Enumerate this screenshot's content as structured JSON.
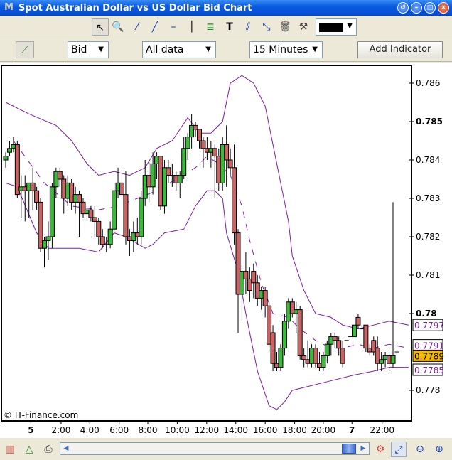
{
  "window": {
    "title": "Spot Australian Dollar vs US Dollar Bid Chart",
    "buttons": [
      "help",
      "minimize",
      "maximize",
      "close"
    ]
  },
  "toolbar": {
    "tools": [
      "pointer-icon",
      "zoom-in-icon",
      "line-icon",
      "trend-line-icon",
      "horizontal-line-icon",
      "vertical-line-icon",
      "fibonacci-icon",
      "text-icon",
      "parallel-lines-icon",
      "channel-icon",
      "trash-icon",
      "tools-icon"
    ],
    "color": "#000000"
  },
  "controls": {
    "price_type": "Bid",
    "range": "All data",
    "interval": "15 Minutes",
    "add_indicator": "Add Indicator"
  },
  "footer": {
    "copyright": "© IT-Finance.com"
  },
  "chart_data": {
    "type": "candlestick",
    "title": "Spot Australian Dollar vs US Dollar Bid Chart",
    "ylim": [
      0.7772,
      0.7867
    ],
    "yticks": [
      {
        "v": 0.786,
        "label": "0.786",
        "bold": false
      },
      {
        "v": 0.785,
        "label": "0.785",
        "bold": true
      },
      {
        "v": 0.784,
        "label": "0.784",
        "bold": false
      },
      {
        "v": 0.783,
        "label": "0.783",
        "bold": false
      },
      {
        "v": 0.782,
        "label": "0.782",
        "bold": false
      },
      {
        "v": 0.781,
        "label": "0.781",
        "bold": false
      },
      {
        "v": 0.78,
        "label": "0.78",
        "bold": true
      },
      {
        "v": 0.778,
        "label": "0.778",
        "bold": false
      }
    ],
    "xticks": [
      {
        "slot": 6.5,
        "label": "5",
        "bold": true
      },
      {
        "slot": 14.3,
        "label": "2:00"
      },
      {
        "slot": 21.7,
        "label": "4:00"
      },
      {
        "slot": 29.3,
        "label": "6:00"
      },
      {
        "slot": 36.7,
        "label": "8:00"
      },
      {
        "slot": 44.3,
        "label": "10:00"
      },
      {
        "slot": 51.9,
        "label": "12:00"
      },
      {
        "slot": 59.4,
        "label": "14:00"
      },
      {
        "slot": 67,
        "label": "16:00"
      },
      {
        "slot": 74.6,
        "label": "18:00"
      },
      {
        "slot": 82,
        "label": "20:00"
      },
      {
        "slot": 89.4,
        "label": "7",
        "bold": true
      },
      {
        "slot": 97.2,
        "label": "22:00"
      }
    ],
    "price_labels": [
      {
        "v": 0.7797,
        "label": "0.7797",
        "kind": "upper"
      },
      {
        "v": 0.7791,
        "label": "0.7791",
        "kind": "middle"
      },
      {
        "v": 0.7789,
        "label": "0.7789",
        "kind": "last"
      },
      {
        "v": 0.7785,
        "label": "0.7785",
        "kind": "lower"
      }
    ],
    "colors": {
      "up": "#3cb93c",
      "down": "#c86464",
      "band": "#7a1fa8",
      "last_bg": "#f5b800"
    },
    "candles": [
      [
        0.784,
        0.7842,
        0.7838,
        0.7841
      ],
      [
        0.7842,
        0.7845,
        0.7841,
        0.7843
      ],
      [
        0.7843,
        0.7846,
        0.7842,
        0.7844
      ],
      [
        0.7844,
        0.7845,
        0.783,
        0.7831
      ],
      [
        0.7832,
        0.7836,
        0.7825,
        0.7833
      ],
      [
        0.7833,
        0.7836,
        0.7824,
        0.7832
      ],
      [
        0.7832,
        0.7834,
        0.7825,
        0.7834
      ],
      [
        0.7834,
        0.7838,
        0.7827,
        0.7832
      ],
      [
        0.7832,
        0.7833,
        0.7827,
        0.7829
      ],
      [
        0.7829,
        0.783,
        0.7816,
        0.7817
      ],
      [
        0.7817,
        0.782,
        0.7812,
        0.7819
      ],
      [
        0.7819,
        0.7824,
        0.7814,
        0.782
      ],
      [
        0.782,
        0.7834,
        0.7817,
        0.7833
      ],
      [
        0.7833,
        0.7838,
        0.783,
        0.7837
      ],
      [
        0.7837,
        0.7838,
        0.7833,
        0.7835
      ],
      [
        0.7835,
        0.7836,
        0.7826,
        0.783
      ],
      [
        0.783,
        0.7836,
        0.7828,
        0.7834
      ],
      [
        0.7834,
        0.7835,
        0.7827,
        0.7829
      ],
      [
        0.7829,
        0.7833,
        0.7826,
        0.7831
      ],
      [
        0.7831,
        0.7832,
        0.782,
        0.7829
      ],
      [
        0.7829,
        0.783,
        0.7825,
        0.7826
      ],
      [
        0.7826,
        0.7828,
        0.7824,
        0.7827
      ],
      [
        0.7827,
        0.7828,
        0.7824,
        0.7825
      ],
      [
        0.7825,
        0.7828,
        0.782,
        0.7824
      ],
      [
        0.7824,
        0.7825,
        0.7818,
        0.782
      ],
      [
        0.782,
        0.7822,
        0.7817,
        0.7818
      ],
      [
        0.7818,
        0.782,
        0.7816,
        0.7818
      ],
      [
        0.7818,
        0.7824,
        0.7817,
        0.7822
      ],
      [
        0.7822,
        0.7834,
        0.7821,
        0.7832
      ],
      [
        0.7832,
        0.7838,
        0.783,
        0.7834
      ],
      [
        0.7834,
        0.7838,
        0.783,
        0.7831
      ],
      [
        0.7831,
        0.7837,
        0.7818,
        0.782
      ],
      [
        0.782,
        0.7822,
        0.7815,
        0.7819
      ],
      [
        0.7819,
        0.7824,
        0.7816,
        0.7821
      ],
      [
        0.7821,
        0.7825,
        0.7818,
        0.782
      ],
      [
        0.782,
        0.7832,
        0.7818,
        0.783
      ],
      [
        0.783,
        0.784,
        0.7828,
        0.7836
      ],
      [
        0.7836,
        0.784,
        0.7829,
        0.7833
      ],
      [
        0.7833,
        0.7842,
        0.7831,
        0.7839
      ],
      [
        0.7839,
        0.7842,
        0.7835,
        0.7841
      ],
      [
        0.7841,
        0.7841,
        0.7827,
        0.7828
      ],
      [
        0.7828,
        0.784,
        0.7826,
        0.7838
      ],
      [
        0.7838,
        0.784,
        0.7834,
        0.7836
      ],
      [
        0.7836,
        0.7839,
        0.7833,
        0.7836
      ],
      [
        0.7836,
        0.7837,
        0.7832,
        0.7834
      ],
      [
        0.7834,
        0.7837,
        0.783,
        0.7836
      ],
      [
        0.7836,
        0.7846,
        0.7835,
        0.7843
      ],
      [
        0.7843,
        0.7847,
        0.784,
        0.7846
      ],
      [
        0.7846,
        0.7852,
        0.7843,
        0.7849
      ],
      [
        0.7849,
        0.785,
        0.7846,
        0.7848
      ],
      [
        0.7848,
        0.7848,
        0.7843,
        0.7845
      ],
      [
        0.7845,
        0.7846,
        0.7838,
        0.7843
      ],
      [
        0.7843,
        0.7846,
        0.784,
        0.7842
      ],
      [
        0.7842,
        0.7845,
        0.7838,
        0.7843
      ],
      [
        0.7843,
        0.7844,
        0.783,
        0.7841
      ],
      [
        0.7841,
        0.7843,
        0.7832,
        0.7834
      ],
      [
        0.7834,
        0.7846,
        0.7832,
        0.7844
      ],
      [
        0.7844,
        0.7849,
        0.7833,
        0.784
      ],
      [
        0.784,
        0.7843,
        0.7836,
        0.7838
      ],
      [
        0.7838,
        0.7844,
        0.7818,
        0.7821
      ],
      [
        0.7821,
        0.7822,
        0.7795,
        0.7805
      ],
      [
        0.7805,
        0.7813,
        0.7798,
        0.7811
      ],
      [
        0.7811,
        0.7816,
        0.7805,
        0.7809
      ],
      [
        0.7809,
        0.7812,
        0.7803,
        0.7806
      ],
      [
        0.7811,
        0.7813,
        0.7804,
        0.7808
      ],
      [
        0.7808,
        0.781,
        0.7802,
        0.7804
      ],
      [
        0.7804,
        0.7807,
        0.7801,
        0.7806
      ],
      [
        0.7806,
        0.7807,
        0.7799,
        0.7802
      ],
      [
        0.7802,
        0.7803,
        0.779,
        0.7792
      ],
      [
        0.7795,
        0.7797,
        0.7785,
        0.7787
      ],
      [
        0.7787,
        0.779,
        0.7785,
        0.7786
      ],
      [
        0.7786,
        0.7792,
        0.7785,
        0.7791
      ],
      [
        0.7791,
        0.78,
        0.7789,
        0.7798
      ],
      [
        0.7798,
        0.7804,
        0.7796,
        0.7803
      ],
      [
        0.7803,
        0.7804,
        0.7799,
        0.78
      ],
      [
        0.78,
        0.7803,
        0.7795,
        0.7801
      ],
      [
        0.7801,
        0.7802,
        0.7788,
        0.7789
      ],
      [
        0.7789,
        0.7791,
        0.7786,
        0.7788
      ],
      [
        0.7788,
        0.7793,
        0.7786,
        0.7787
      ],
      [
        0.7787,
        0.7792,
        0.7786,
        0.7791
      ],
      [
        0.7791,
        0.7792,
        0.7786,
        0.7787
      ],
      [
        0.7787,
        0.779,
        0.7785,
        0.7786
      ],
      [
        0.7786,
        0.779,
        0.7785,
        0.7789
      ],
      [
        0.7789,
        0.7793,
        0.7787,
        0.7792
      ],
      [
        0.7792,
        0.7795,
        0.7789,
        0.7794
      ],
      [
        0.7794,
        0.7795,
        0.7791,
        0.7793
      ],
      [
        0.7793,
        0.7794,
        0.7789,
        0.7791
      ],
      [
        0.7791,
        0.7793,
        0.7786,
        0.7787
      ],
      [
        0.7793,
        0.7793,
        0.7793,
        0.7793
      ],
      [
        0.7794,
        0.7794,
        0.7794,
        0.7794
      ],
      [
        0.7794,
        0.7797,
        0.7794,
        0.7797
      ],
      [
        0.7799,
        0.78,
        0.7796,
        0.7797
      ],
      [
        0.7796,
        0.7797,
        0.7796,
        0.7796
      ],
      [
        0.7797,
        0.7797,
        0.779,
        0.7791
      ],
      [
        0.7791,
        0.7792,
        0.7789,
        0.779
      ],
      [
        0.7793,
        0.7794,
        0.7789,
        0.779
      ],
      [
        0.7791,
        0.7794,
        0.7785,
        0.7787
      ],
      [
        0.7787,
        0.779,
        0.7785,
        0.7788
      ],
      [
        0.7788,
        0.779,
        0.7786,
        0.7789
      ],
      [
        0.7789,
        0.779,
        0.7785,
        0.7787
      ],
      [
        0.7787,
        0.7829,
        0.7786,
        0.7789
      ],
      [
        0.779,
        0.779,
        0.7789,
        0.779
      ]
    ],
    "bands": {
      "upper": [
        [
          0,
          0.7855
        ],
        [
          6,
          0.7852
        ],
        [
          13,
          0.7849
        ],
        [
          17,
          0.7845
        ],
        [
          21,
          0.7839
        ],
        [
          24,
          0.7836
        ],
        [
          28,
          0.7837
        ],
        [
          32,
          0.7836
        ],
        [
          36,
          0.7838
        ],
        [
          39,
          0.7843
        ],
        [
          43,
          0.7845
        ],
        [
          47,
          0.7851
        ],
        [
          50,
          0.7847
        ],
        [
          53,
          0.7847
        ],
        [
          56,
          0.785
        ],
        [
          58,
          0.786
        ],
        [
          61,
          0.7862
        ],
        [
          64,
          0.786
        ],
        [
          67,
          0.7854
        ],
        [
          70,
          0.7839
        ],
        [
          73,
          0.7824
        ],
        [
          74,
          0.7815
        ],
        [
          77,
          0.7806
        ],
        [
          80,
          0.78
        ],
        [
          84,
          0.7799
        ],
        [
          87,
          0.7797
        ],
        [
          91,
          0.7796
        ],
        [
          95,
          0.7797
        ],
        [
          99,
          0.7798
        ],
        [
          104,
          0.7797
        ]
      ],
      "middle": [
        [
          2,
          0.7845
        ],
        [
          10,
          0.7834
        ],
        [
          17,
          0.7828
        ],
        [
          24,
          0.7827
        ],
        [
          29,
          0.7828
        ],
        [
          34,
          0.783
        ],
        [
          39,
          0.7832
        ],
        [
          44,
          0.7835
        ],
        [
          49,
          0.7838
        ],
        [
          52,
          0.7841
        ],
        [
          55,
          0.7839
        ],
        [
          58,
          0.7836
        ],
        [
          61,
          0.7828
        ],
        [
          63,
          0.7819
        ],
        [
          66,
          0.7808
        ],
        [
          69,
          0.78
        ],
        [
          73,
          0.7799
        ],
        [
          76,
          0.7796
        ],
        [
          80,
          0.7793
        ],
        [
          84,
          0.7791
        ],
        [
          87,
          0.7791
        ],
        [
          91,
          0.7792
        ],
        [
          95,
          0.7791
        ],
        [
          99,
          0.7792
        ],
        [
          104,
          0.7791
        ]
      ],
      "lower": [
        [
          0,
          0.7834
        ],
        [
          3,
          0.7833
        ],
        [
          8,
          0.7821
        ],
        [
          11,
          0.7817
        ],
        [
          19,
          0.7817
        ],
        [
          24,
          0.7816
        ],
        [
          28,
          0.7821
        ],
        [
          31,
          0.782
        ],
        [
          36,
          0.7817
        ],
        [
          38,
          0.7818
        ],
        [
          41,
          0.7821
        ],
        [
          46,
          0.7822
        ],
        [
          49,
          0.7828
        ],
        [
          52,
          0.7832
        ],
        [
          54,
          0.7832
        ],
        [
          56,
          0.783
        ],
        [
          57,
          0.7821
        ],
        [
          60,
          0.7811
        ],
        [
          62,
          0.78
        ],
        [
          65,
          0.7785
        ],
        [
          68,
          0.7776
        ],
        [
          70,
          0.7775
        ],
        [
          72,
          0.7777
        ],
        [
          74,
          0.778
        ],
        [
          78,
          0.7781
        ],
        [
          82,
          0.7782
        ],
        [
          86,
          0.7783
        ],
        [
          90,
          0.7784
        ],
        [
          95,
          0.7785
        ],
        [
          99,
          0.7786
        ],
        [
          104,
          0.7786
        ]
      ]
    }
  }
}
